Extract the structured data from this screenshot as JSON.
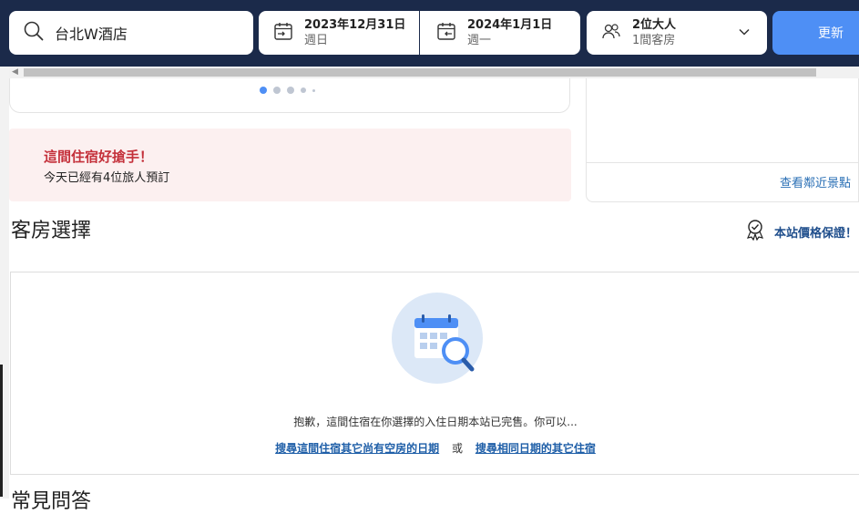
{
  "search": {
    "destination": "台北W酒店",
    "update_label": "更新"
  },
  "dates": {
    "checkin": {
      "date": "2023年12月31日",
      "weekday": "週日"
    },
    "checkout": {
      "date": "2024年1月1日",
      "weekday": "週一"
    }
  },
  "guests": {
    "adults": "2位大人",
    "rooms": "1間客房"
  },
  "alert": {
    "title": "這間住宿好搶手！",
    "message": "今天已經有4位旅人預訂"
  },
  "map": {
    "nearby_link": "查看鄰近景點"
  },
  "rooms": {
    "heading": "客房選擇",
    "guarantee": "本站價格保證！",
    "sorry_text": "抱歉，這間住宿在你選擇的入住日期本站已完售。你可以...",
    "link_other_dates": "搜尋這間住宿其它尚有空房的日期",
    "or_text": "或",
    "link_other_hotels": "搜尋相同日期的其它住宿"
  },
  "next_heading": "常見問答",
  "carousel": {
    "total_dots": 5,
    "active_index": 0
  },
  "colors": {
    "topbar": "#1b2a4a",
    "accent": "#4e8ff5",
    "link": "#1f5fa8",
    "alert_bg": "#fcf0f0",
    "alert_title": "#c4303a"
  }
}
